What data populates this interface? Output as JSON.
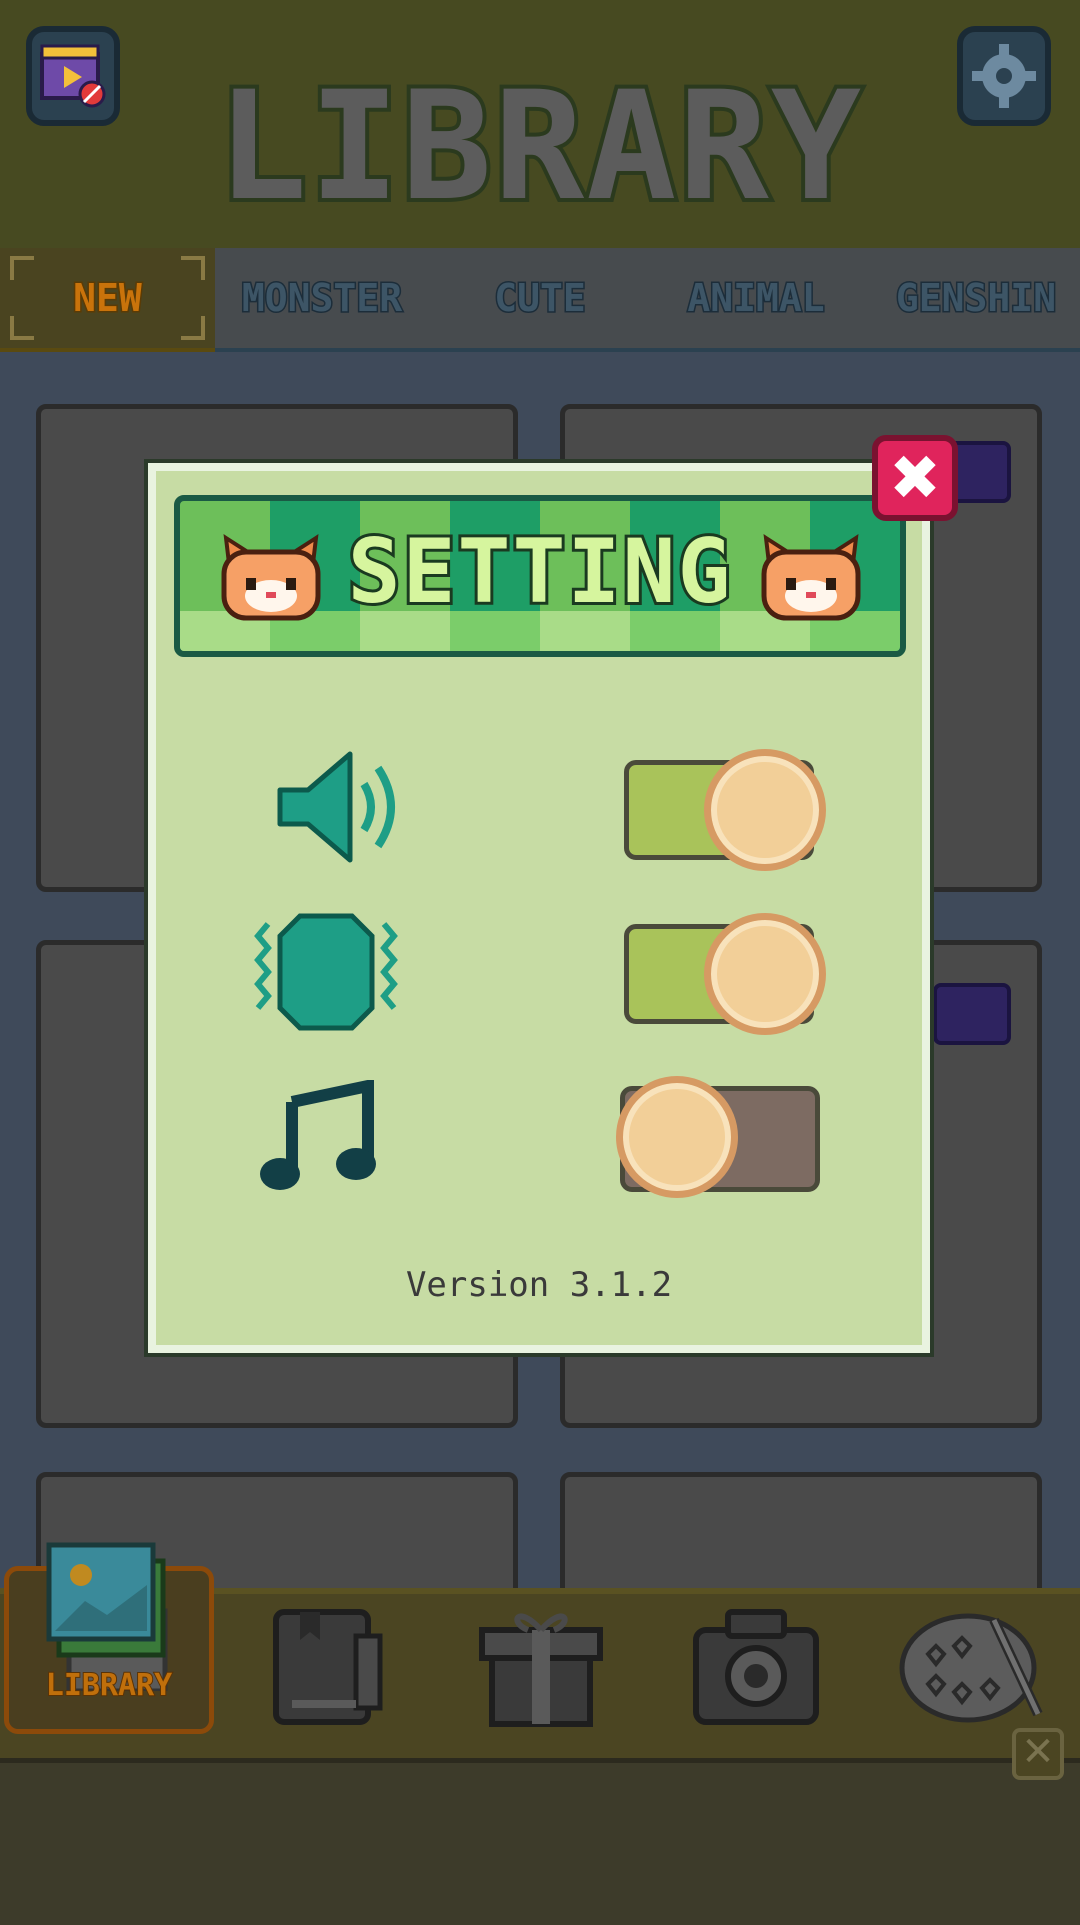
{
  "header": {
    "title": "LIBRARY"
  },
  "tabs": [
    {
      "label": "NEW",
      "selected": true
    },
    {
      "label": "MONSTER"
    },
    {
      "label": "CUTE"
    },
    {
      "label": "ANIMAL"
    },
    {
      "label": "GENSHIN"
    }
  ],
  "bottom_nav": {
    "library_label": "LIBRARY",
    "items": [
      "library-icon",
      "book-icon",
      "gift-icon",
      "camera-icon",
      "palette-icon"
    ]
  },
  "settings_modal": {
    "title": "SETTING",
    "toggles": [
      {
        "icon": "sound-icon",
        "on": true
      },
      {
        "icon": "vibration-icon",
        "on": true
      },
      {
        "icon": "music-note-icon",
        "on": false
      }
    ],
    "version": "Version 3.1.2",
    "close_glyph": "✖"
  },
  "ad_close_glyph": "✕",
  "colors": {
    "toggle_on": "#a9c35a",
    "toggle_off": "#7d6b62",
    "accent_orange": "#c9730b",
    "modal_bg": "#c7dca4"
  }
}
